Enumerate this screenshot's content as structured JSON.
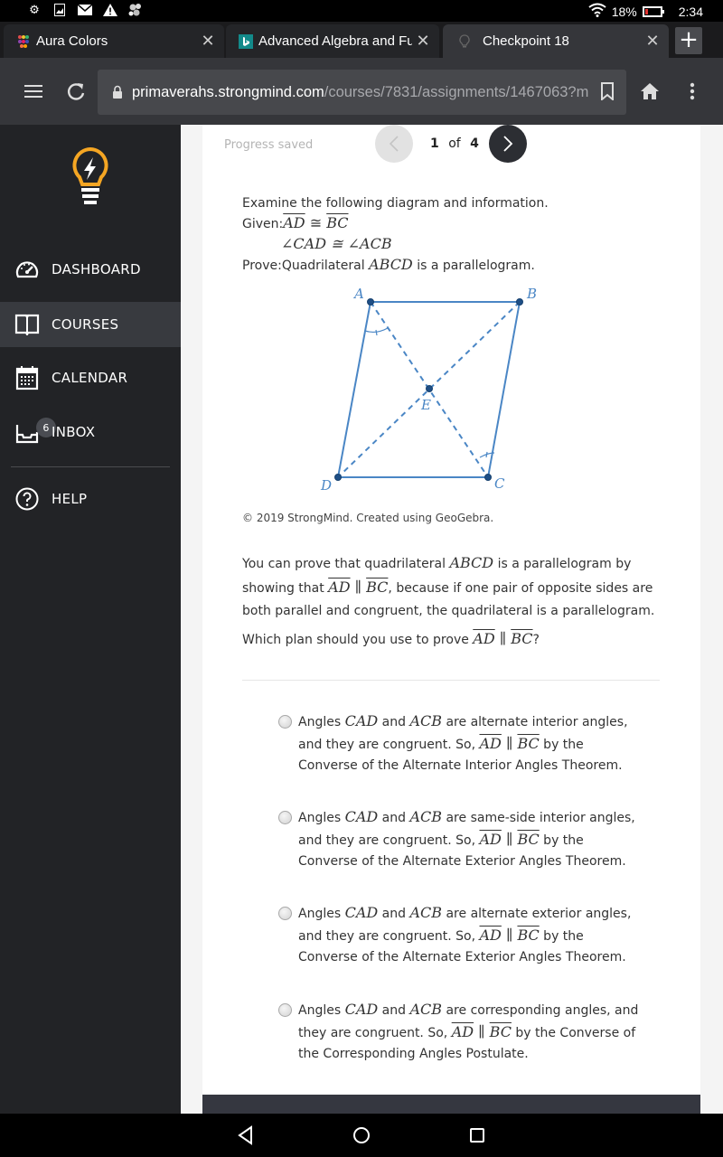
{
  "status_bar": {
    "icons": [
      "settings-icon",
      "image-icon",
      "mail-icon",
      "warning-icon",
      "app-icon"
    ],
    "battery_percent": "18%",
    "battery_level": 0.18,
    "time": "2:34"
  },
  "tabs": [
    {
      "title": "Aura Colors",
      "favicon": "aura-dots-icon",
      "close": "✕",
      "active": false
    },
    {
      "title": "Advanced Algebra and Funct",
      "favicon": "bing-icon",
      "close": "✕",
      "active": false
    },
    {
      "title": "Checkpoint 18",
      "favicon": "lightbulb-icon",
      "close": "✕",
      "active": true
    }
  ],
  "new_tab_label": "+",
  "toolbar": {
    "url_host": "primaverahs.strongmind.com",
    "url_path": "/courses/7831/assignments/1467063?m"
  },
  "sidebar": {
    "items": [
      {
        "label": "DASHBOARD",
        "icon": "dashboard-gauge-icon",
        "active": false
      },
      {
        "label": "COURSES",
        "icon": "book-icon",
        "active": true
      },
      {
        "label": "CALENDAR",
        "icon": "calendar-icon",
        "active": false
      },
      {
        "label": "INBOX",
        "icon": "inbox-icon",
        "active": false,
        "badge": "6"
      },
      {
        "label": "HELP",
        "icon": "help-icon",
        "active": false
      }
    ]
  },
  "assessment": {
    "progress_status": "Progress saved",
    "pager": {
      "current": "1",
      "of": "of",
      "total": "4"
    },
    "intro": "Examine the following diagram and information.",
    "given_label": "Given:",
    "given_1_left": "AD",
    "given_1_op": " ≅ ",
    "given_1_right": "BC",
    "given_2": "∠CAD ≅ ∠ACB",
    "prove_label": "Prove:",
    "prove_text_1": "Quadrilateral ",
    "prove_math": "ABCD",
    "prove_text_2": " is a parallelogram.",
    "diagram_labels": {
      "A": "A",
      "B": "B",
      "C": "C",
      "D": "D",
      "E": "E"
    },
    "copyright": "© 2019 StrongMind. Created using GeoGebra.",
    "explanation": {
      "t1": "You can prove that quadrilateral ",
      "m1": "ABCD",
      "t2": " is a parallelogram by showing that ",
      "m2": "AD",
      "par": " ∥ ",
      "m3": "BC",
      "t3": ", because if one pair of opposite sides are both parallel and congruent, the quadrilateral is a parallelogram."
    },
    "question": {
      "t1": "Which plan should you use to prove ",
      "m1": "AD",
      "par": " ∥ ",
      "m2": "BC",
      "t2": "?"
    },
    "options": [
      {
        "pre": "Angles ",
        "a1": "CAD",
        "and": " and ",
        "a2": "ACB",
        "mid": " are alternate interior angles, and they are congruent. So, ",
        "s1": "AD",
        "par": " ∥ ",
        "s2": "BC",
        "post": " by the Converse of the Alternate Interior Angles Theorem."
      },
      {
        "pre": "Angles ",
        "a1": "CAD",
        "and": " and ",
        "a2": "ACB",
        "mid": " are same-side interior angles, and they are congruent. So, ",
        "s1": "AD",
        "par": " ∥ ",
        "s2": "BC",
        "post": " by the Converse of the Alternate Exterior Angles Theorem."
      },
      {
        "pre": "Angles ",
        "a1": "CAD",
        "and": " and ",
        "a2": "ACB",
        "mid": " are alternate exterior angles, and they are congruent. So, ",
        "s1": "AD",
        "par": " ∥ ",
        "s2": "BC",
        "post": " by the Converse of the Alternate Exterior Angles Theorem."
      },
      {
        "pre": "Angles ",
        "a1": "CAD",
        "and": " and ",
        "a2": "ACB",
        "mid": " are corresponding angles, and they are congruent. So, ",
        "s1": "AD",
        "par": " ∥ ",
        "s2": "BC",
        "post": " by the Converse of the Corresponding Angles Postulate."
      }
    ]
  },
  "colors": {
    "sidebar_bg": "#222326",
    "sidebar_active": "#383a3f",
    "logo_yellow": "#f5a623",
    "diagram_blue": "#4a86c5",
    "next_button": "#2c2e33"
  }
}
